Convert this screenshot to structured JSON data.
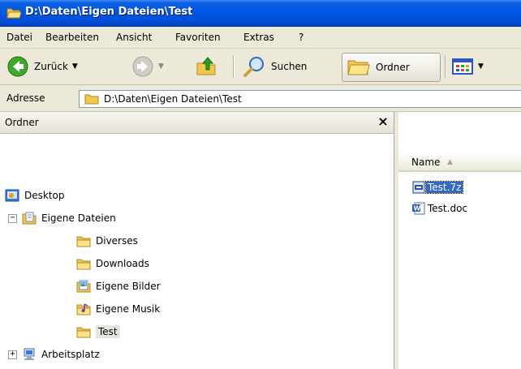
{
  "window": {
    "title": "D:\\Daten\\Eigen Dateien\\Test"
  },
  "menu": [
    "Datei",
    "Bearbeiten",
    "Ansicht",
    "Favoriten",
    "Extras",
    "?"
  ],
  "toolbar": {
    "back_label": "Zurück",
    "search_label": "Suchen",
    "folders_label": "Ordner"
  },
  "address": {
    "label": "Adresse",
    "path": "D:\\Daten\\Eigen Dateien\\Test"
  },
  "folder_pane": {
    "title": "Ordner",
    "close_glyph": "×",
    "tree": [
      {
        "label": "Desktop",
        "icon": "desktop-icon"
      },
      {
        "label": "Eigene Dateien",
        "icon": "my-documents-icon",
        "expander": "−"
      },
      {
        "label": "Diverses",
        "icon": "folder-icon"
      },
      {
        "label": "Downloads",
        "icon": "folder-icon"
      },
      {
        "label": "Eigene Bilder",
        "icon": "my-pictures-icon"
      },
      {
        "label": "Eigene Musik",
        "icon": "my-music-icon"
      },
      {
        "label": "Test",
        "icon": "folder-icon",
        "selected": true
      },
      {
        "label": "Arbeitsplatz",
        "icon": "my-computer-icon",
        "expander": "+"
      }
    ]
  },
  "file_pane": {
    "column_name": "Name",
    "files": [
      {
        "name": "Test.7z",
        "icon": "archive-icon",
        "selected": true
      },
      {
        "name": "Test.doc",
        "icon": "word-document-icon"
      }
    ]
  },
  "colors": {
    "titlebar": "#0055e5",
    "selection": "#316ac5",
    "chrome": "#ece9d8"
  }
}
